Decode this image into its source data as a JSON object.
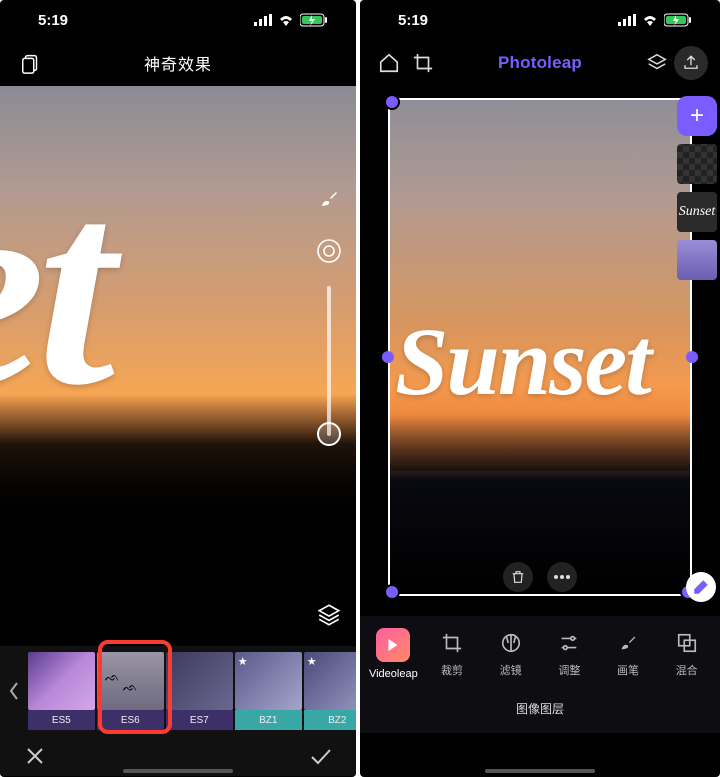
{
  "left": {
    "status": {
      "time": "5:19"
    },
    "title": "神奇效果",
    "canvas_text": "set",
    "effects": [
      {
        "id": "es5",
        "label": "ES5",
        "group": "es",
        "starred": false
      },
      {
        "id": "es6",
        "label": "ES6",
        "group": "es",
        "starred": false,
        "selected": true
      },
      {
        "id": "es7",
        "label": "ES7",
        "group": "es",
        "starred": false
      },
      {
        "id": "bz1",
        "label": "BZ1",
        "group": "bz",
        "starred": true
      },
      {
        "id": "bz2",
        "label": "BZ2",
        "group": "bz",
        "starred": true
      }
    ]
  },
  "right": {
    "status": {
      "time": "5:19"
    },
    "brand": "Photoleap",
    "canvas_text": "Sunset",
    "side_tiles": {
      "add": "+",
      "sunset_label": "Sunset"
    },
    "toolbar": [
      {
        "id": "videoleap",
        "label": "Videoleap"
      },
      {
        "id": "crop",
        "label": "裁剪"
      },
      {
        "id": "filter",
        "label": "滤镜"
      },
      {
        "id": "adjust",
        "label": "调整"
      },
      {
        "id": "brush",
        "label": "画笔"
      },
      {
        "id": "blend",
        "label": "混合"
      }
    ],
    "layer_label": "图像图层"
  }
}
